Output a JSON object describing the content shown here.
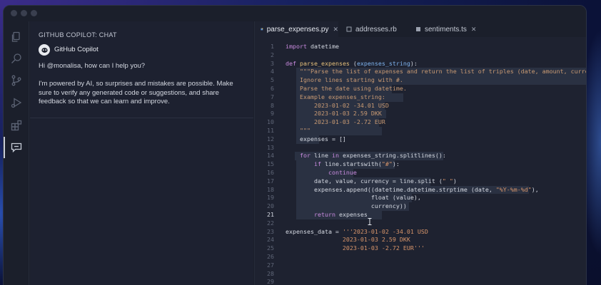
{
  "chat": {
    "title": "GITHUB COPILOT: CHAT",
    "assistant_name": "GitHub Copilot",
    "greeting": "Hi @monalisa, how can I help you?",
    "disclaimer": "I'm powered by AI, so surprises and mistakes are possible. Make sure to verify any generated code or suggestions, and share feedback so that we can learn and improve."
  },
  "tabs": [
    {
      "label": "parse_expenses.py",
      "icon": "python-file-icon",
      "active": true,
      "close": "✕"
    },
    {
      "label": "addresses.rb",
      "icon": "ruby-file-icon",
      "active": false,
      "close": "✕"
    },
    {
      "label": "sentiments.ts",
      "icon": "typescript-file-icon",
      "active": false,
      "close": "✕"
    }
  ],
  "editor": {
    "current_line": 21,
    "lines": [
      {
        "n": "1",
        "text": "import datetime"
      },
      {
        "n": "2",
        "text": ""
      },
      {
        "n": "3",
        "text": "def parse_expenses (expenses_string):"
      },
      {
        "n": "4",
        "text": "    \"\"\"Parse the list of expenses and return the list of triples (date, amount, currency"
      },
      {
        "n": "5",
        "text": "    Ignore lines starting with #."
      },
      {
        "n": "6",
        "text": "    Parse the date using datetime."
      },
      {
        "n": "7",
        "text": "    Example expenses_string:"
      },
      {
        "n": "8",
        "text": "        2023-01-02 -34.01 USD"
      },
      {
        "n": "9",
        "text": "        2023-01-03 2.59 DKK"
      },
      {
        "n": "10",
        "text": "        2023-01-03 -2.72 EUR"
      },
      {
        "n": "11",
        "text": "    \"\"\""
      },
      {
        "n": "12",
        "text": "    expenses = []"
      },
      {
        "n": "13",
        "text": ""
      },
      {
        "n": "14",
        "text": "    for line in expenses_string.splitlines():"
      },
      {
        "n": "15",
        "text": "        if line.startswith(\"#\"):"
      },
      {
        "n": "16",
        "text": "            continue"
      },
      {
        "n": "17",
        "text": "        date, value, currency = line.split (\" \")"
      },
      {
        "n": "18",
        "text": "        expenses.append((datetime.datetime.strptime (date, \"%Y-%m-%d\"),"
      },
      {
        "n": "19",
        "text": "                        float (value),"
      },
      {
        "n": "20",
        "text": "                        currency))"
      },
      {
        "n": "21",
        "text": "        return expenses"
      },
      {
        "n": "22",
        "text": ""
      },
      {
        "n": "23",
        "text": "expenses_data = '''2023-01-02 -34.01 USD"
      },
      {
        "n": "24",
        "text": "                2023-01-03 2.59 DKK"
      },
      {
        "n": "25",
        "text": "                2023-01-03 -2.72 EUR'''"
      },
      {
        "n": "26",
        "text": ""
      },
      {
        "n": "27",
        "text": ""
      },
      {
        "n": "28",
        "text": ""
      },
      {
        "n": "29",
        "text": ""
      }
    ]
  },
  "colors": {
    "keyword": "#c98bdf",
    "function": "#e5c07b",
    "parameter": "#7fb4f0",
    "string": "#d7956a",
    "suggestion_highlight": "#2a3142"
  }
}
